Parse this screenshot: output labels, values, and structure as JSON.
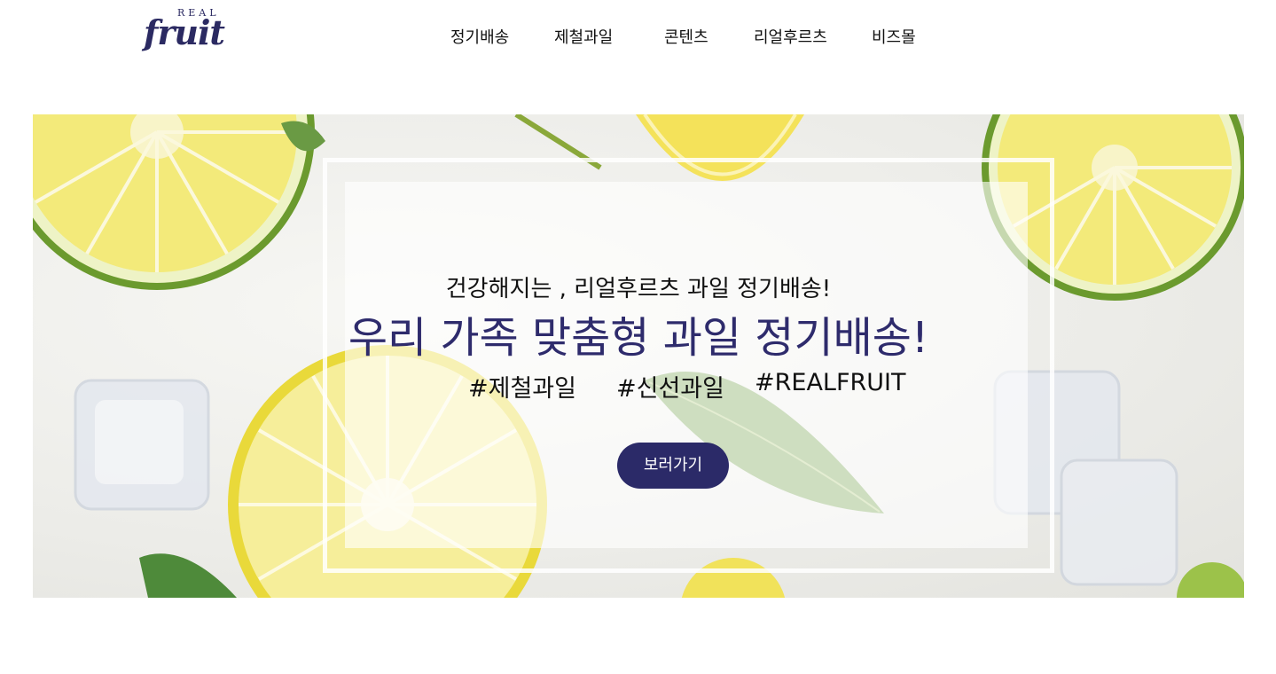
{
  "brand": {
    "logo_top": "REAL",
    "logo_main": "fruit",
    "color": "#2b2a62"
  },
  "nav": {
    "items": [
      {
        "label": "정기배송"
      },
      {
        "label": "제철과일"
      },
      {
        "label": "콘텐츠"
      },
      {
        "label": "리얼후르츠"
      },
      {
        "label": "비즈몰"
      }
    ]
  },
  "hero": {
    "subheadline": "건강해지는 , 리얼후르츠 과일 정기배송!",
    "headline": "우리 가족 맞춤형 과일 정기배송!",
    "tags": [
      "#제철과일",
      "#신선과일",
      "#REALFRUIT"
    ],
    "cta_label": "보러가기",
    "accent": "#2e2b6c",
    "cta_color": "#2b2a68"
  }
}
